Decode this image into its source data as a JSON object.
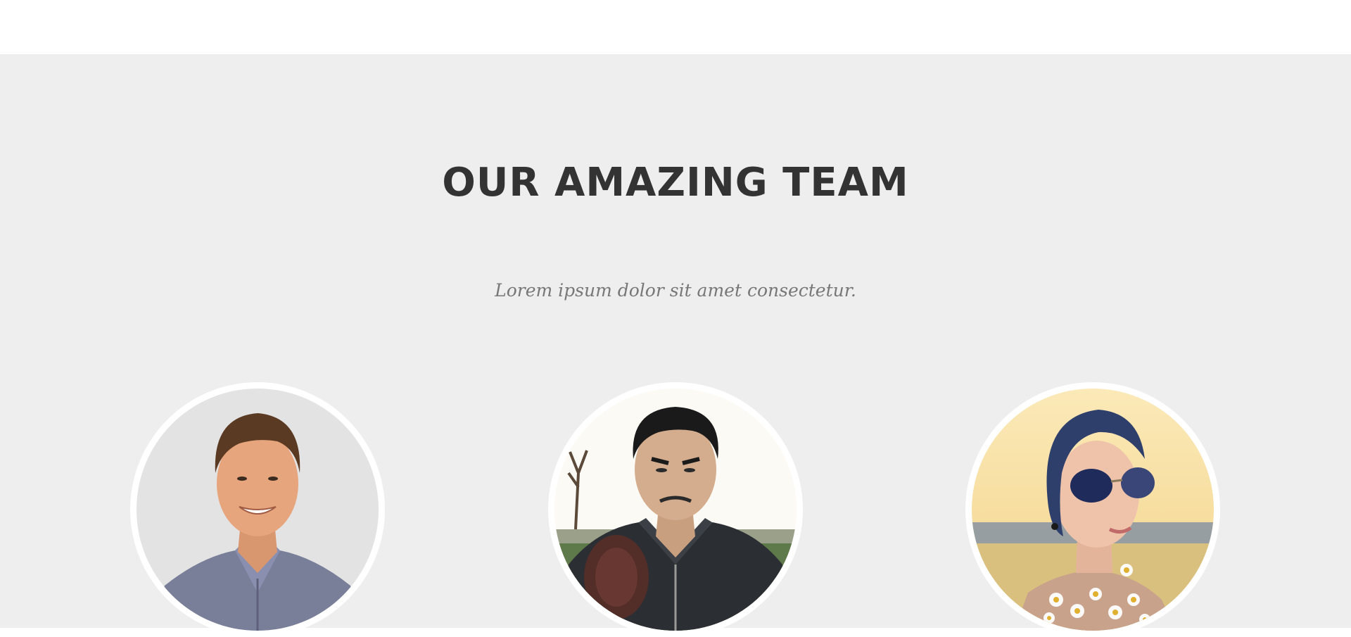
{
  "section": {
    "title": "OUR AMAZING TEAM",
    "subtitle": "Lorem ipsum dolor sit amet consectetur."
  },
  "colors": {
    "page_background": "#ffffff",
    "section_background": "#eeeeee",
    "title": "#333333",
    "subtitle": "#777777",
    "photo_border": "#ffffff"
  },
  "members": [
    {
      "photo": "man-smiling-blue-shirt-portrait"
    },
    {
      "photo": "man-leather-jacket-pointing-portrait"
    },
    {
      "photo": "woman-aviator-sunglasses-flowers-portrait"
    }
  ]
}
